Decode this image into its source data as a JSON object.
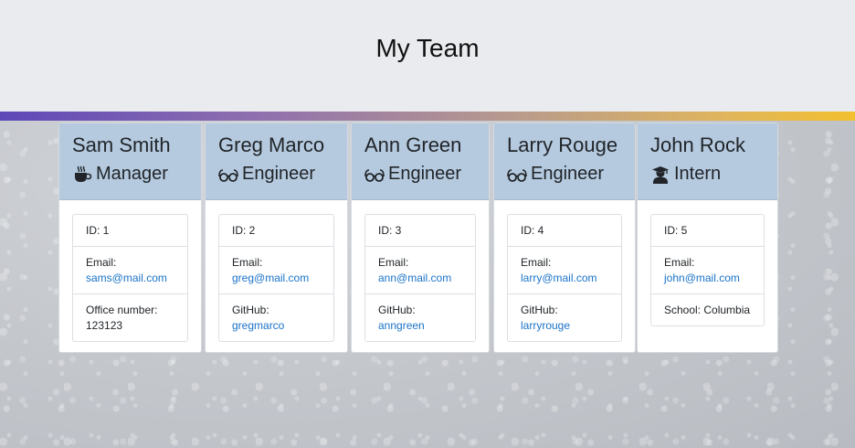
{
  "header": {
    "title": "My Team"
  },
  "employees": [
    {
      "name": "Sam Smith",
      "role": "Manager",
      "role_icon": "coffee-icon",
      "id_text": "ID: 1",
      "email_label": "Email:",
      "email": "sams@mail.com",
      "extra_label": "Office number:",
      "extra_value": "123123"
    },
    {
      "name": "Greg Marco",
      "role": "Engineer",
      "role_icon": "glasses-icon",
      "id_text": "ID: 2",
      "email_label": "Email:",
      "email": "greg@mail.com",
      "extra_label": "GitHub:",
      "extra_value": "gregmarco"
    },
    {
      "name": "Ann Green",
      "role": "Engineer",
      "role_icon": "glasses-icon",
      "id_text": "ID: 3",
      "email_label": "Email:",
      "email": "ann@mail.com",
      "extra_label": "GitHub:",
      "extra_value": "anngreen"
    },
    {
      "name": "Larry Rouge",
      "role": "Engineer",
      "role_icon": "glasses-icon",
      "id_text": "ID: 4",
      "email_label": "Email:",
      "email": "larry@mail.com",
      "extra_label": "GitHub:",
      "extra_value": "larryrouge"
    },
    {
      "name": "John Rock",
      "role": "Intern",
      "role_icon": "user-graduate-icon",
      "id_text": "ID: 5",
      "email_label": "Email:",
      "email": "john@mail.com",
      "extra_label": "School:",
      "extra_value": "Columbia"
    }
  ],
  "colors": {
    "card_header": "#b5cadf",
    "link": "#1a73c8",
    "accent_start": "#5e48b8",
    "accent_end": "#f2c02f"
  }
}
